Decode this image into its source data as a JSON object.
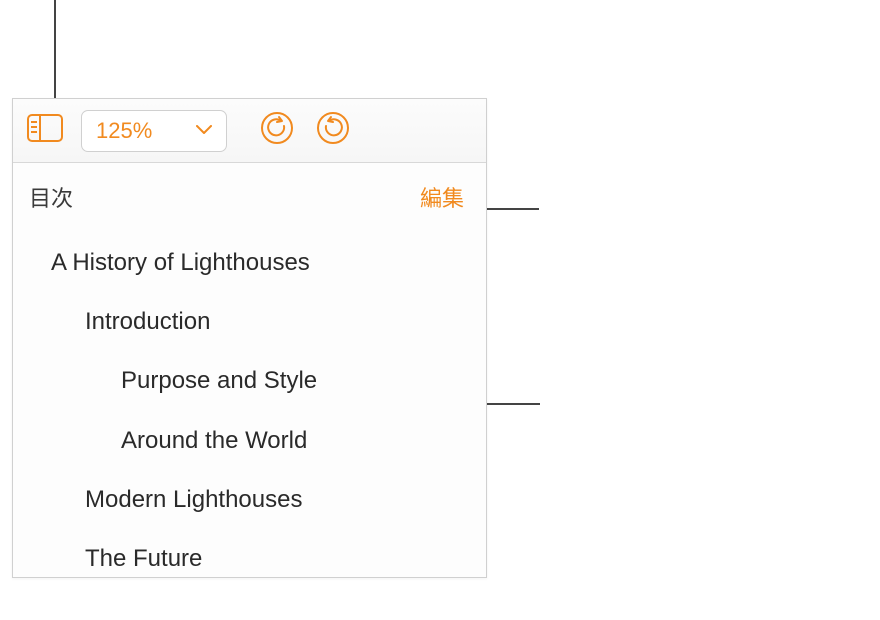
{
  "toolbar": {
    "zoom_label": "125%"
  },
  "sidebar": {
    "title": "目次",
    "edit_label": "編集",
    "items": [
      {
        "label": "A History of Lighthouses",
        "level": 1
      },
      {
        "label": "Introduction",
        "level": 2
      },
      {
        "label": "Purpose and Style",
        "level": 3
      },
      {
        "label": "Around the World",
        "level": 3
      },
      {
        "label": "Modern Lighthouses",
        "level": 2
      },
      {
        "label": "The Future",
        "level": 2
      }
    ]
  },
  "colors": {
    "accent": "#f18a1f"
  }
}
